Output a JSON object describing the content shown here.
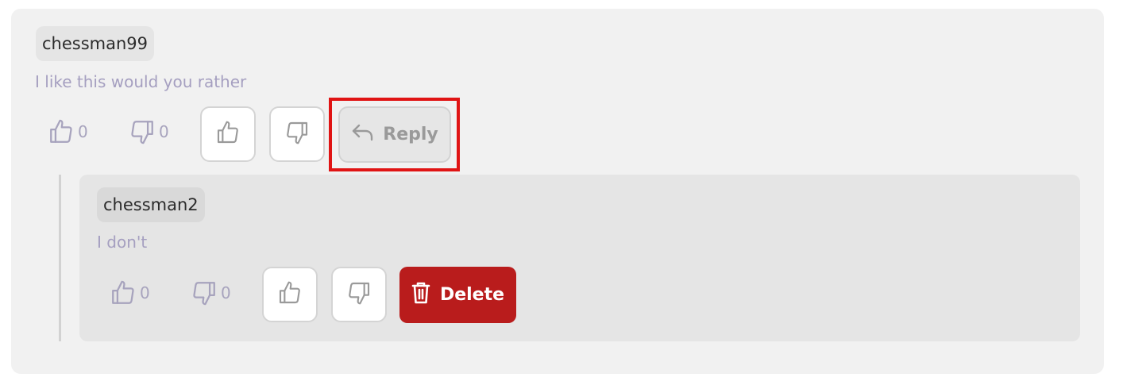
{
  "comment": {
    "username": "chessman99",
    "text": "I like this would you rather",
    "likes": "0",
    "dislikes": "0",
    "reply_label": "Reply"
  },
  "reply": {
    "username": "chessman2",
    "text": "I don't",
    "likes": "0",
    "dislikes": "0",
    "delete_label": "Delete"
  },
  "colors": {
    "delete_button": "#b91c1c",
    "highlight": "#e01414",
    "comment_text": "#a59fc0"
  }
}
